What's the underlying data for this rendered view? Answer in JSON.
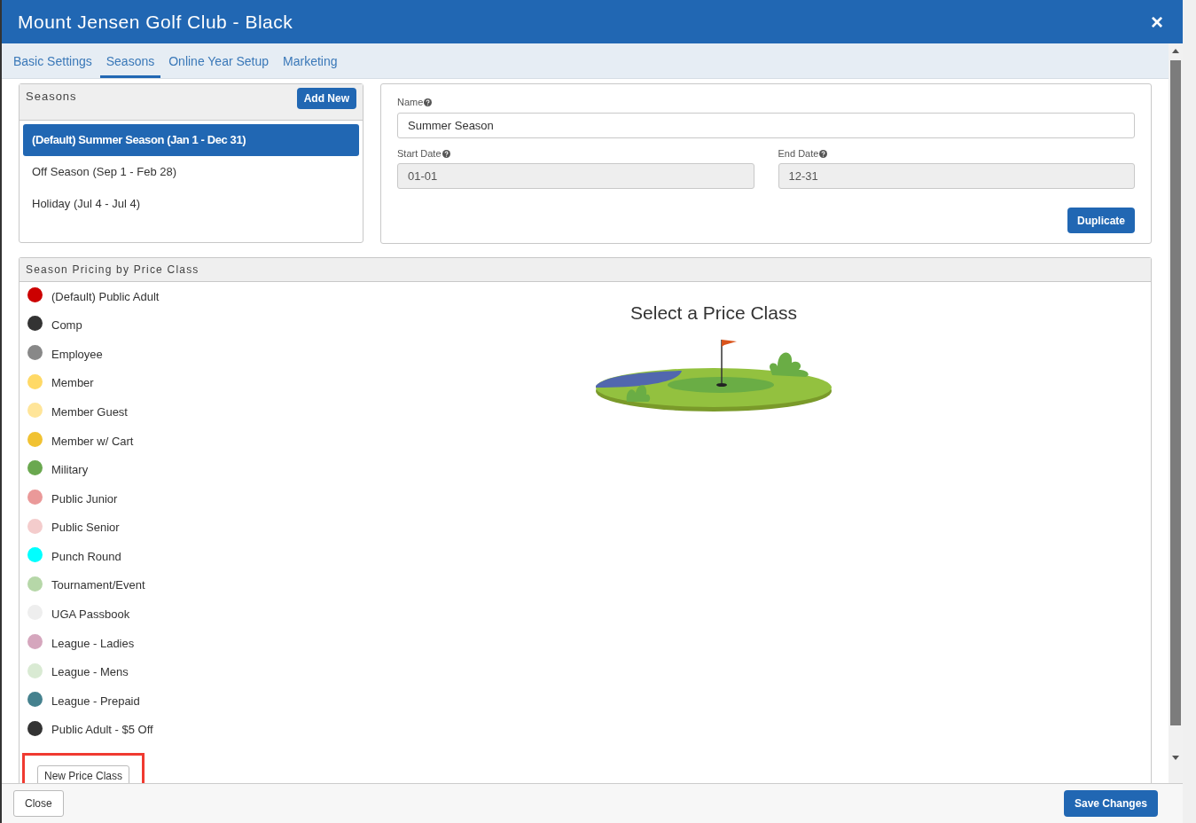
{
  "window": {
    "title": "Mount Jensen Golf Club - Black",
    "close_label": "×"
  },
  "tabs": [
    {
      "label": "Basic Settings",
      "selected": false
    },
    {
      "label": "Seasons",
      "selected": true
    },
    {
      "label": "Online Year Setup",
      "selected": false
    },
    {
      "label": "Marketing",
      "selected": false
    }
  ],
  "seasons": {
    "title": "Seasons",
    "add_button": "Add New",
    "items": [
      {
        "label": "(Default) Summer Season (Jan 1 - Dec 31)",
        "selected": true
      },
      {
        "label": "Off Season (Sep 1 - Feb 28)",
        "selected": false
      },
      {
        "label": "Holiday (Jul 4 - Jul 4)",
        "selected": false
      }
    ]
  },
  "season_form": {
    "name": {
      "label": "Name",
      "value": "Summer Season"
    },
    "start_date": {
      "label": "Start Date",
      "value": "01-01",
      "disabled": true
    },
    "end_date": {
      "label": "End Date",
      "value": "12-31",
      "disabled": true
    },
    "duplicate_button": "Duplicate"
  },
  "pricing": {
    "title": "Season Pricing by Price Class",
    "empty_title": "Select a Price Class",
    "new_button": "New Price Class",
    "new_button_highlighted": true,
    "price_classes": [
      {
        "label": "(Default) Public Adult",
        "color": "#cc0000"
      },
      {
        "label": "Comp",
        "color": "#333333"
      },
      {
        "label": "Employee",
        "color": "#888888"
      },
      {
        "label": "Member",
        "color": "#ffd966"
      },
      {
        "label": "Member Guest",
        "color": "#ffe599"
      },
      {
        "label": "Member w/ Cart",
        "color": "#f1c232"
      },
      {
        "label": "Military",
        "color": "#6aa84f"
      },
      {
        "label": "Public Junior",
        "color": "#ea9999"
      },
      {
        "label": "Public Senior",
        "color": "#f4cccc"
      },
      {
        "label": "Punch Round",
        "color": "#00ffff"
      },
      {
        "label": "Tournament/Event",
        "color": "#b6d7a8"
      },
      {
        "label": "UGA Passbook",
        "color": "#eeeeee"
      },
      {
        "label": "League - Ladies",
        "color": "#d5a6bd"
      },
      {
        "label": "League - Mens",
        "color": "#d9ead3"
      },
      {
        "label": "League - Prepaid",
        "color": "#45818e"
      },
      {
        "label": "Public Adult - $5 Off",
        "color": "#333333"
      }
    ]
  },
  "footer": {
    "close_button": "Close",
    "save_button": "Save Changes"
  }
}
